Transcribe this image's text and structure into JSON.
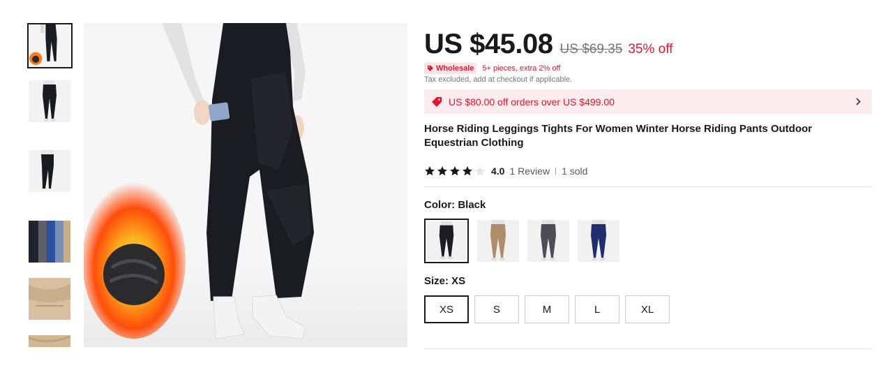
{
  "price": {
    "current": "US $45.08",
    "original": "US $69.35",
    "discount": "35% off"
  },
  "wholesale": {
    "badge": "Wholesale",
    "text": "5+ pieces, extra 2% off"
  },
  "tax_note": "Tax excluded, add at checkout if applicable.",
  "coupon": {
    "text": "US $80.00 off orders over US $499.00"
  },
  "product": {
    "title": "Horse Riding Leggings Tights For Women Winter Horse Riding Pants Outdoor Equestrian Clothing",
    "rating": 4,
    "rating_text": "4.0",
    "reviews": "1 Review",
    "sold": "1 sold"
  },
  "color": {
    "label": "Color: Black",
    "selected": "Black",
    "options": [
      {
        "name": "Black",
        "hex": "#1c1d22"
      },
      {
        "name": "Khaki",
        "hex": "#b08d6a"
      },
      {
        "name": "Gray",
        "hex": "#4c4e55"
      },
      {
        "name": "Navy",
        "hex": "#1f2f6e"
      }
    ]
  },
  "size": {
    "label": "Size: XS",
    "selected": "XS",
    "options": [
      "XS",
      "S",
      "M",
      "L",
      "XL"
    ]
  },
  "thumbnails": [
    {
      "name": "fleece-fire"
    },
    {
      "name": "black-front"
    },
    {
      "name": "black-side"
    },
    {
      "name": "color-collage"
    },
    {
      "name": "khaki-closeup"
    },
    {
      "name": "khaki-detail"
    }
  ],
  "colors": {
    "accent": "#e1152d",
    "coupon_bg": "#fdecee",
    "text": "#191919"
  }
}
